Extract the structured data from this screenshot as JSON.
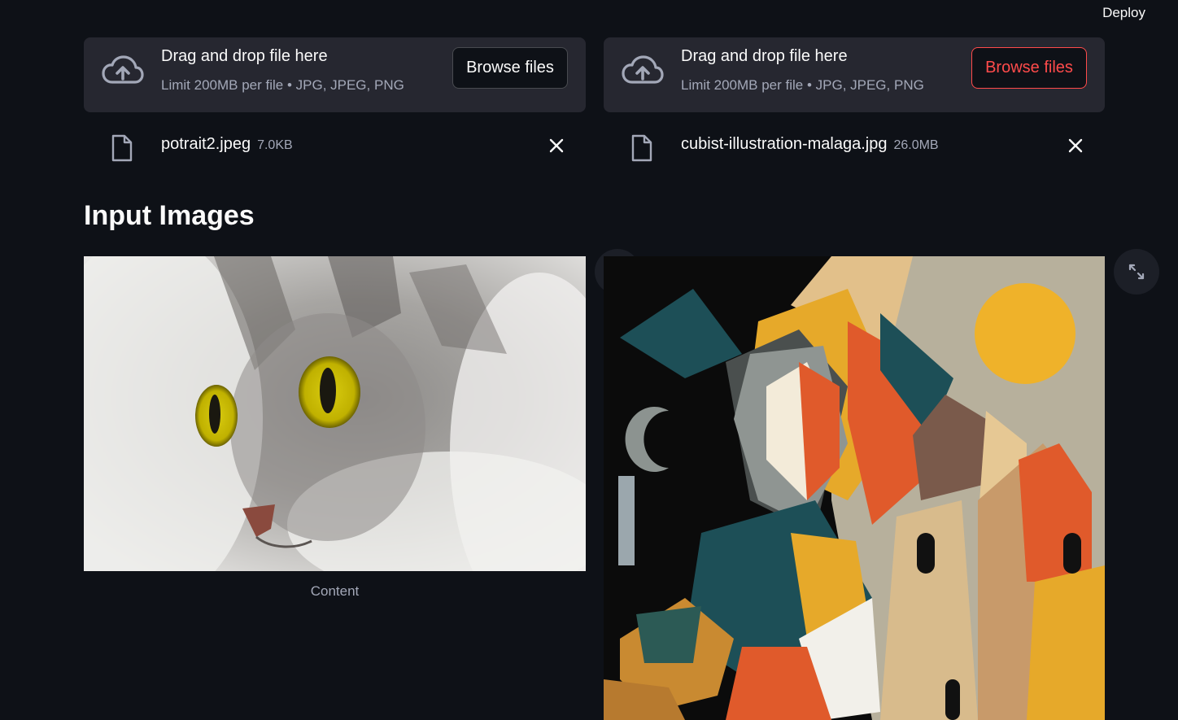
{
  "header": {
    "deploy_label": "Deploy"
  },
  "uploaders": [
    {
      "title": "Drag and drop file here",
      "subtitle": "Limit 200MB per file • JPG, JPEG, PNG",
      "button_label": "Browse files",
      "file": {
        "name": "potrait2.jpeg",
        "size": "7.0KB"
      }
    },
    {
      "title": "Drag and drop file here",
      "subtitle": "Limit 200MB per file • JPG, JPEG, PNG",
      "button_label": "Browse files",
      "file": {
        "name": "cubist-illustration-malaga.jpg",
        "size": "26.0MB"
      }
    }
  ],
  "section": {
    "heading": "Input Images"
  },
  "images": [
    {
      "caption": "Content",
      "icon": "fullscreen-expand-icon"
    },
    {
      "caption": "",
      "icon": "fullscreen-expand-icon"
    }
  ],
  "colors": {
    "background": "#0e1117",
    "panel": "#262730",
    "accent": "#ff4b4b",
    "muted": "#a3a8b8"
  }
}
